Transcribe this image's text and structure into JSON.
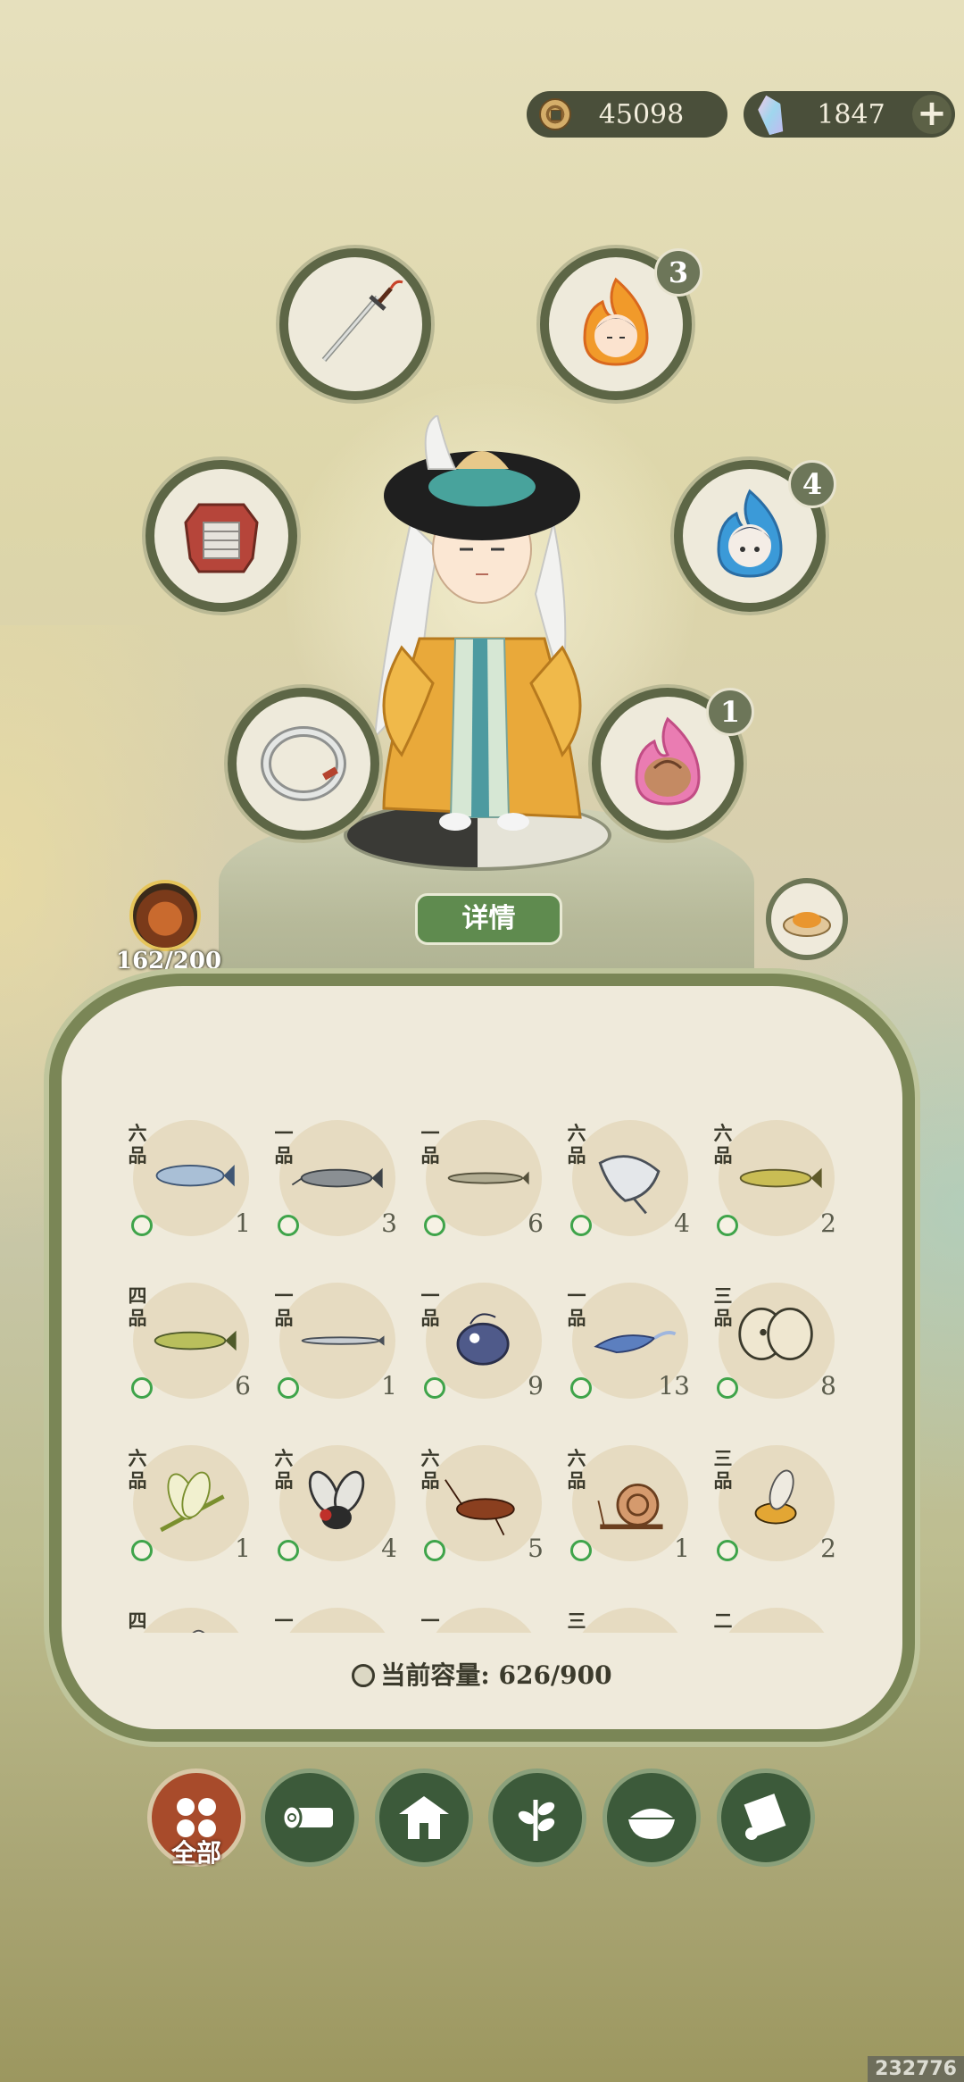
{
  "currency": {
    "coins": "45098",
    "gems": "1847"
  },
  "slots": {
    "talisman_a_badge": "3",
    "talisman_b_badge": "4",
    "talisman_c_badge": "1"
  },
  "character": {
    "detail_label": "详情",
    "stamina": "162/200"
  },
  "inventory": {
    "items": [
      {
        "grade": "六品",
        "qty": "1",
        "icon": "fish-salmon"
      },
      {
        "grade": "一品",
        "qty": "3",
        "icon": "fish-catfish"
      },
      {
        "grade": "一品",
        "qty": "6",
        "icon": "fish-gar"
      },
      {
        "grade": "六品",
        "qty": "4",
        "icon": "fish-ray"
      },
      {
        "grade": "六品",
        "qty": "2",
        "icon": "fish-pike"
      },
      {
        "grade": "四品",
        "qty": "6",
        "icon": "fish-pike-green"
      },
      {
        "grade": "一品",
        "qty": "1",
        "icon": "fish-needle"
      },
      {
        "grade": "一品",
        "qty": "9",
        "icon": "fish-angler"
      },
      {
        "grade": "一品",
        "qty": "13",
        "icon": "fish-blue"
      },
      {
        "grade": "三品",
        "qty": "8",
        "icon": "moth"
      },
      {
        "grade": "六品",
        "qty": "1",
        "icon": "dragonfly"
      },
      {
        "grade": "六品",
        "qty": "4",
        "icon": "fly"
      },
      {
        "grade": "六品",
        "qty": "5",
        "icon": "cockroach"
      },
      {
        "grade": "六品",
        "qty": "1",
        "icon": "snail"
      },
      {
        "grade": "三品",
        "qty": "2",
        "icon": "wasp"
      },
      {
        "grade": "四品",
        "qty": "",
        "icon": "bee"
      },
      {
        "grade": "一品",
        "qty": "",
        "icon": "seed"
      },
      {
        "grade": "一品",
        "qty": "",
        "icon": "scorpion"
      },
      {
        "grade": "三品",
        "qty": "",
        "icon": "rice-sack"
      },
      {
        "grade": "二品",
        "qty": "",
        "icon": "lavender"
      }
    ],
    "capacity_label": "当前容量: 626/900"
  },
  "categories": {
    "all_label": "全部"
  },
  "watermark": "232776"
}
